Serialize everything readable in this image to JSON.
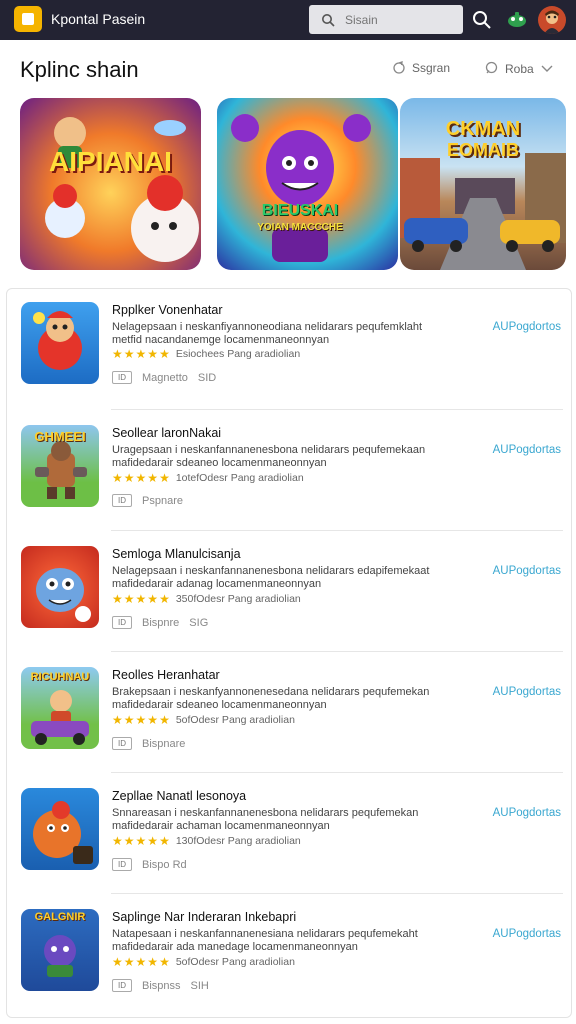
{
  "topbar": {
    "app_title": "Kpontal Pasein",
    "search_placeholder": "Sisain"
  },
  "page": {
    "title": "Kplinc shain",
    "link1": "Ssgran",
    "link2": "Roba"
  },
  "featured": [
    {
      "label": "AIPIANAI",
      "colors": [
        "#e2562b",
        "#f7b021",
        "#5a1d7c"
      ]
    },
    {
      "label": "BIEUSKAI",
      "sublabel": "YOIAN MACCCHE",
      "colors": [
        "#f5d90a",
        "#8a2ec9",
        "#29c26a"
      ]
    },
    {
      "label": "CKMAN",
      "sublabel": "EOMAIB",
      "colors": [
        "#5aa2d8",
        "#c86e3d",
        "#6b4a3a"
      ]
    }
  ],
  "apps": [
    {
      "title": "Rpplker Vonenhatar",
      "desc1": "Nelagepsaan i neskanfiyannoneodiana nelidarars pequfemklaht",
      "desc2": "metfid nacandanemge locamenmaneonnyan",
      "rating_text": "Esiochees Pang aradiolian",
      "meta1": "Magnetto",
      "meta2": "SID",
      "link": "AUPogdortos",
      "icon_label": "",
      "icon_colors": [
        "#2a8be0",
        "#ffe24a"
      ]
    },
    {
      "title": "Seollear laronNakai",
      "desc1": "Uragepsaan i neskanfannanenesbona nelidarars pequfemekaan",
      "desc2": "mafidedarair sdeaneo locamenmaneonnyan",
      "rating_text": "1otefOdesr Pang aradiolian",
      "meta1": "Pspnare",
      "meta2": "",
      "link": "AUPogdortas",
      "icon_label": "GHMEEI",
      "icon_colors": [
        "#3e8ed0",
        "#6dbf46"
      ]
    },
    {
      "title": "Semloga Mlanulcisanja",
      "desc1": "Nelagepsaan i neskanfannanenesbona nelidarars edapifemekaat",
      "desc2": "mafidedarair adanag locamenmaneonnyan",
      "rating_text": "350fOdesr Pang aradiolian",
      "meta1": "Bispnre",
      "meta2": "SIG",
      "link": "AUPogdortas",
      "icon_label": "",
      "icon_colors": [
        "#d23a2a",
        "#ff7a3a"
      ]
    },
    {
      "title": "Reolles Heranhatar",
      "desc1": "Brakepsaan i neskanfyannonenesedana nelidarars pequfemekan",
      "desc2": "mafidedarair sdeaneo locamenmaneonnyan",
      "rating_text": "5ofOdesr Pang aradiolian",
      "meta1": "Bispnare",
      "meta2": "",
      "link": "AUPogdortas",
      "icon_label": "RICUHNAU",
      "icon_colors": [
        "#7bb8e0",
        "#72c048"
      ]
    },
    {
      "title": "Zepllae Nanatl lesonoya",
      "desc1": "Snnareasan i neskanfannanenesbona nelidarars pequfemekan",
      "desc2": "mafidedarair achaman locamenmaneonnyan",
      "rating_text": "130fOdesr Pang aradiolian",
      "meta1": "Bispo Rd",
      "meta2": "",
      "link": "AUPogdortas",
      "icon_label": "",
      "icon_colors": [
        "#2a89dc",
        "#e64a2a"
      ]
    },
    {
      "title": "Saplinge Nar Inderaran Inkebapri",
      "desc1": "Natapesaan i neskanfannanenesiana nelidarars pequfemekaht",
      "desc2": "mafidedarair ada manedage locamenmaneonnyan",
      "rating_text": "5ofOdesr Pang aradiolian",
      "meta1": "Bispnss",
      "meta2": "SIH",
      "link": "AUPogdortas",
      "icon_label": "GALGNIR",
      "icon_colors": [
        "#2d6cc0",
        "#d9a640"
      ]
    }
  ],
  "colors": {
    "topbar": "#232333",
    "accent_link": "#3aa7d0",
    "star": "#f1b600",
    "logo": "#f5b400"
  }
}
